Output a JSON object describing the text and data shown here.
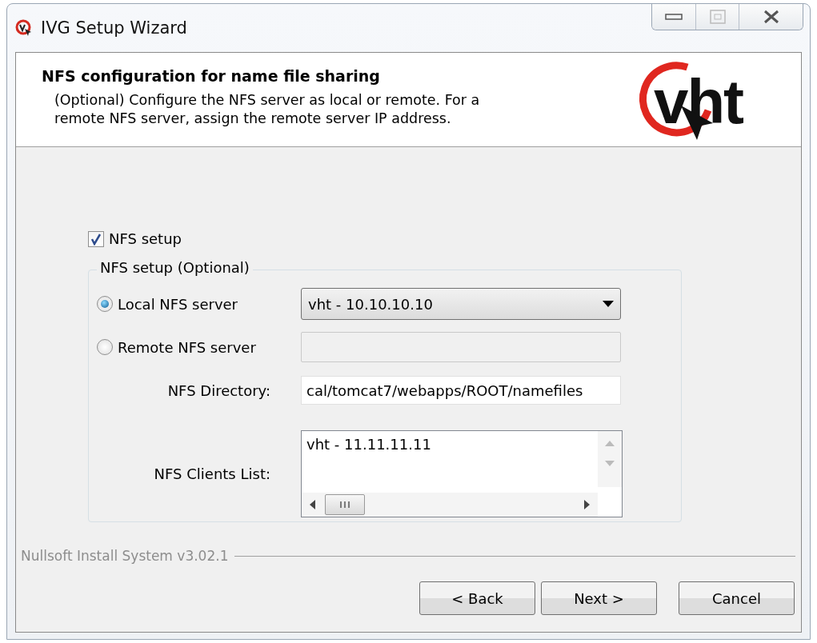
{
  "window": {
    "title": "IVG Setup Wizard"
  },
  "header": {
    "title": "NFS configuration for name file sharing",
    "description": "(Optional) Configure the NFS server as local or remote. For a remote NFS server, assign the remote server IP address.",
    "logo": "vht"
  },
  "nfs_setup": {
    "label": "NFS setup",
    "checked": true
  },
  "group": {
    "title": "NFS setup (Optional)",
    "servers": [
      {
        "label": "Local NFS server",
        "selected": true,
        "kind": "dropdown",
        "value": "vht - 10.10.10.10"
      },
      {
        "label": "Remote NFS server",
        "selected": false,
        "kind": "field"
      }
    ],
    "directory": {
      "label": "NFS Directory:",
      "value": "cal/tomcat7/webapps/ROOT/namefiles"
    },
    "clients": {
      "label": "NFS Clients List:",
      "items": [
        "vht - 11.11.11.11"
      ]
    }
  },
  "footer": {
    "brand": "Nullsoft Install System v3.02.1"
  },
  "buttons": [
    "< Back",
    "Next >",
    "Cancel"
  ]
}
